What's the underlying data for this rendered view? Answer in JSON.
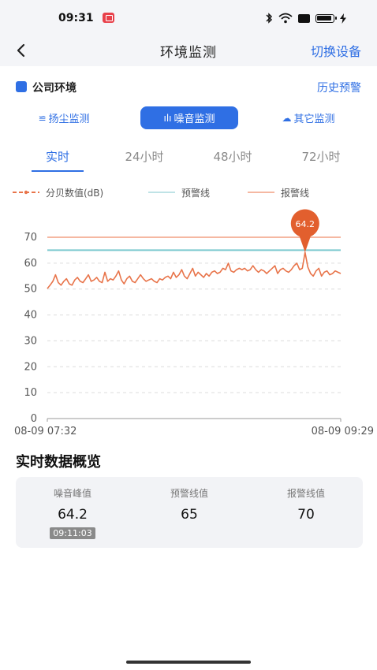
{
  "status_bar": {
    "time": "09:31"
  },
  "nav": {
    "title": "环境监测",
    "switch_device": "切换设备"
  },
  "section": {
    "title": "公司环境",
    "history": "历史预警"
  },
  "monitor_types": {
    "dust": "扬尘监测",
    "noise": "噪音监测",
    "other": "其它监测",
    "selected": "noise"
  },
  "time_tabs": {
    "realtime": "实时",
    "h24": "24小时",
    "h48": "48小时",
    "h72": "72小时",
    "selected": "realtime"
  },
  "legend": {
    "db": "分贝数值(dB)",
    "warn": "预警线",
    "alarm": "报警线"
  },
  "colors": {
    "accent": "#2f6fe4",
    "db_line": "#e8744a",
    "warn_line": "#7cc9cf",
    "alarm_line": "#f5b8a2",
    "peak_marker": "#e25f2e"
  },
  "chart_data": {
    "type": "line",
    "x_start": "08-09 07:32",
    "x_end": "08-09 09:29",
    "ylim": [
      0,
      70
    ],
    "yticks": [
      0,
      10,
      20,
      30,
      40,
      50,
      60,
      70
    ],
    "grid": true,
    "legend_position": "top",
    "series": [
      {
        "name": "分贝数值(dB)",
        "values": [
          50.2,
          51.5,
          53,
          55.5,
          52.5,
          51.5,
          53,
          54,
          52,
          51.5,
          53.5,
          54.5,
          53,
          52.5,
          54,
          55.5,
          53,
          53.5,
          54.5,
          53,
          52.5,
          56.5,
          53,
          54,
          53.5,
          55,
          57,
          53.5,
          52,
          54,
          55,
          53,
          52.5,
          54,
          55.5,
          54,
          53,
          53.5,
          54,
          53,
          52.5,
          54,
          53.5,
          54.5,
          55,
          54,
          56.5,
          54.5,
          55.5,
          57.5,
          55,
          54,
          56,
          58,
          55,
          56.5,
          55.5,
          54.5,
          56,
          55,
          56.5,
          57,
          56,
          56.5,
          58,
          57.5,
          60,
          57,
          56.5,
          57.5,
          58,
          57.5,
          58,
          57,
          57.5,
          59,
          57.5,
          56.5,
          57.5,
          57,
          56,
          57,
          58,
          59,
          56,
          57.5,
          58,
          57,
          56.5,
          57.5,
          59,
          60,
          57.5,
          58,
          64.2,
          58.5,
          56,
          55,
          57,
          58,
          55,
          56.5,
          57,
          55.5,
          56,
          57,
          56.5,
          56
        ]
      }
    ],
    "thresholds": [
      {
        "name": "预警线",
        "value": 65
      },
      {
        "name": "报警线",
        "value": 70
      }
    ],
    "annotation": {
      "label": "64.2",
      "value": 64.2,
      "index": 94
    }
  },
  "summary": {
    "title": "实时数据概览",
    "peak_label": "噪音峰值",
    "peak_value": "64.2",
    "peak_time": "09:11:03",
    "warn_label": "预警线值",
    "warn_value": "65",
    "alarm_label": "报警线值",
    "alarm_value": "70"
  }
}
